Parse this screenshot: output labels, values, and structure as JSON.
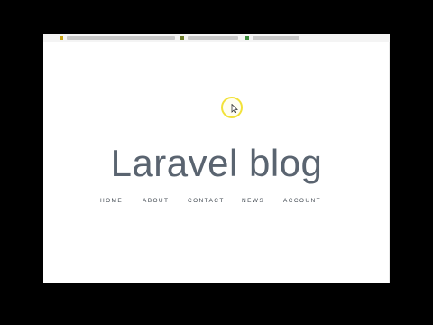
{
  "page": {
    "title": "Laravel blog"
  },
  "nav": {
    "items": [
      {
        "label": "HOME"
      },
      {
        "label": "ABOUT"
      },
      {
        "label": "CONTACT"
      },
      {
        "label": "NEWS"
      },
      {
        "label": "ACCOUNT"
      }
    ]
  },
  "colors": {
    "title": "#5a6470",
    "nav_text": "#404850",
    "cursor_highlight": "#f2e23a",
    "background": "#ffffff",
    "letterbox": "#000000"
  },
  "icons": {
    "cursor": "mouse-pointer-icon",
    "cursor_highlight": "cursor-highlight-ring"
  }
}
